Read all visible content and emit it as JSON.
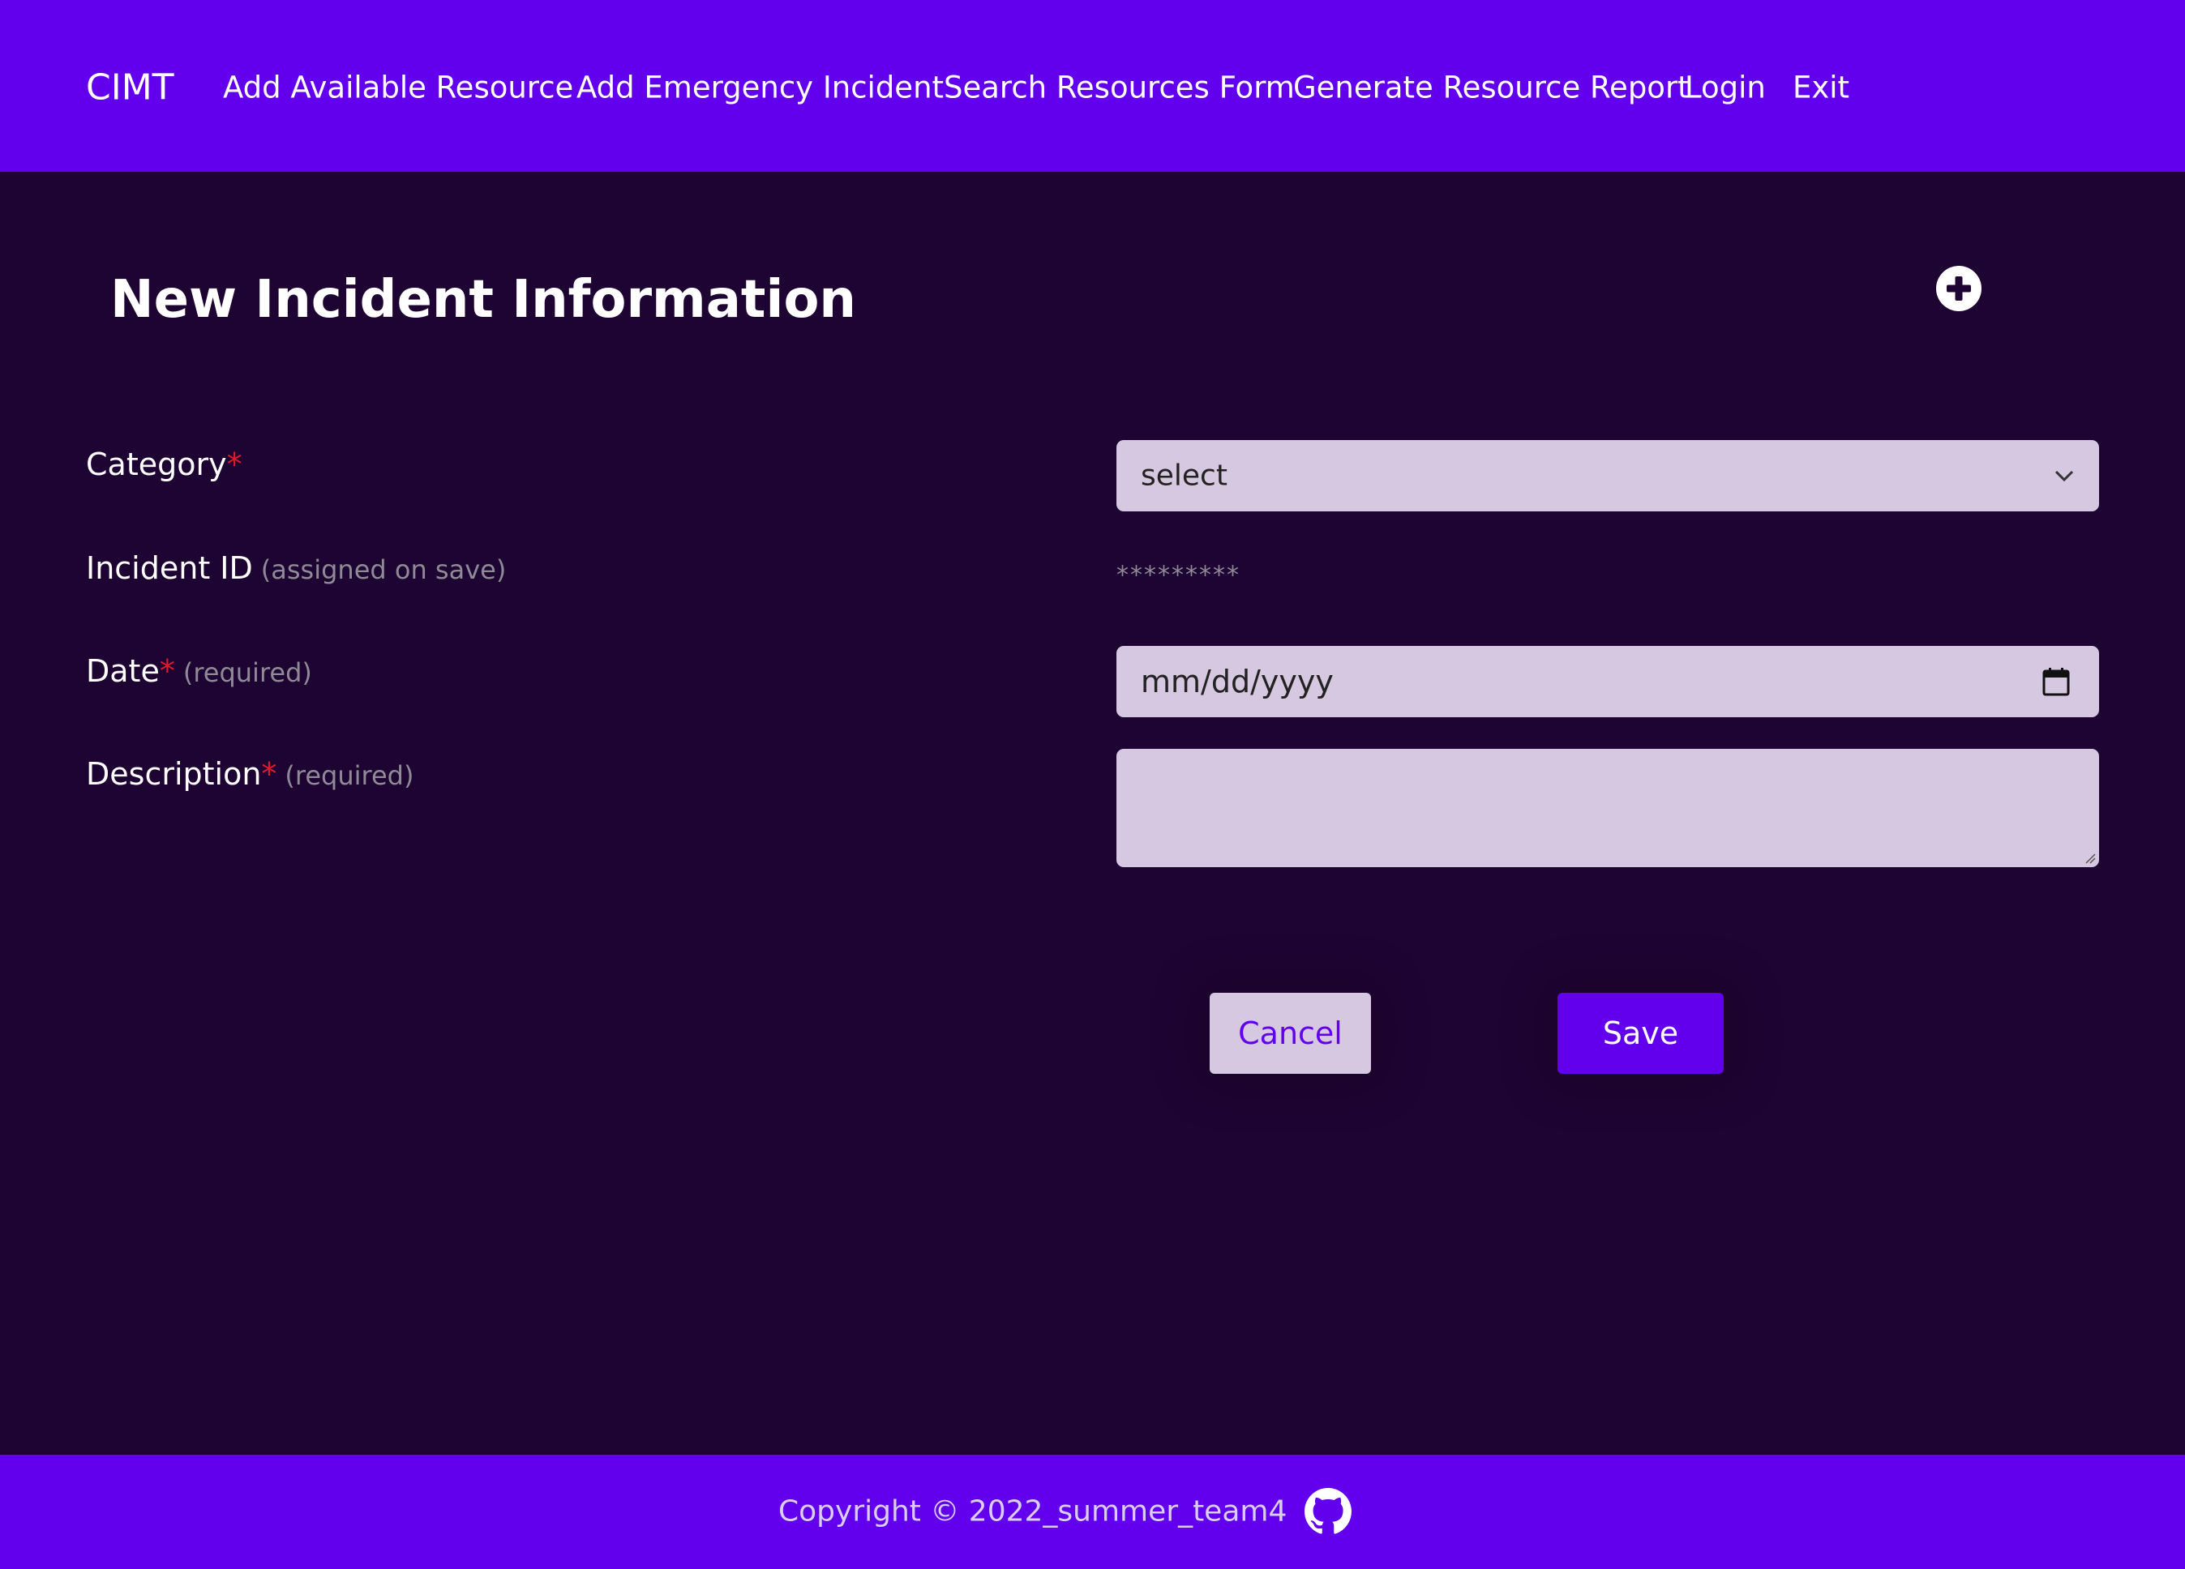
{
  "navbar": {
    "brand": "CIMT",
    "links": [
      {
        "label": "Add Available Resource"
      },
      {
        "label": "Add Emergency Incident"
      },
      {
        "label": "Search Resources Form"
      },
      {
        "label": "Generate Resource Report"
      },
      {
        "label": "Login"
      },
      {
        "label": "Exit"
      }
    ]
  },
  "form": {
    "title": "New Incident Information",
    "add_icon": "plus-circle-icon",
    "category": {
      "label": "Category",
      "required_mark": "*",
      "value": "select"
    },
    "incident_id": {
      "label": "Incident ID",
      "hint": "(assigned on save)",
      "value": "*********"
    },
    "date": {
      "label": "Date",
      "required_mark": "*",
      "hint": "(required)",
      "placeholder": "mm/dd/yyyy"
    },
    "description": {
      "label": "Description",
      "required_mark": "*",
      "hint": "(required)",
      "value": ""
    },
    "cancel_label": "Cancel",
    "save_label": "Save"
  },
  "footer": {
    "copyright": "Copyright © 2022_summer_team4",
    "github_icon": "github-icon"
  },
  "colors": {
    "brand": "#6200ee",
    "background": "#1e0432",
    "input_bg": "#d6c8e0",
    "required": "#e01a2d"
  }
}
